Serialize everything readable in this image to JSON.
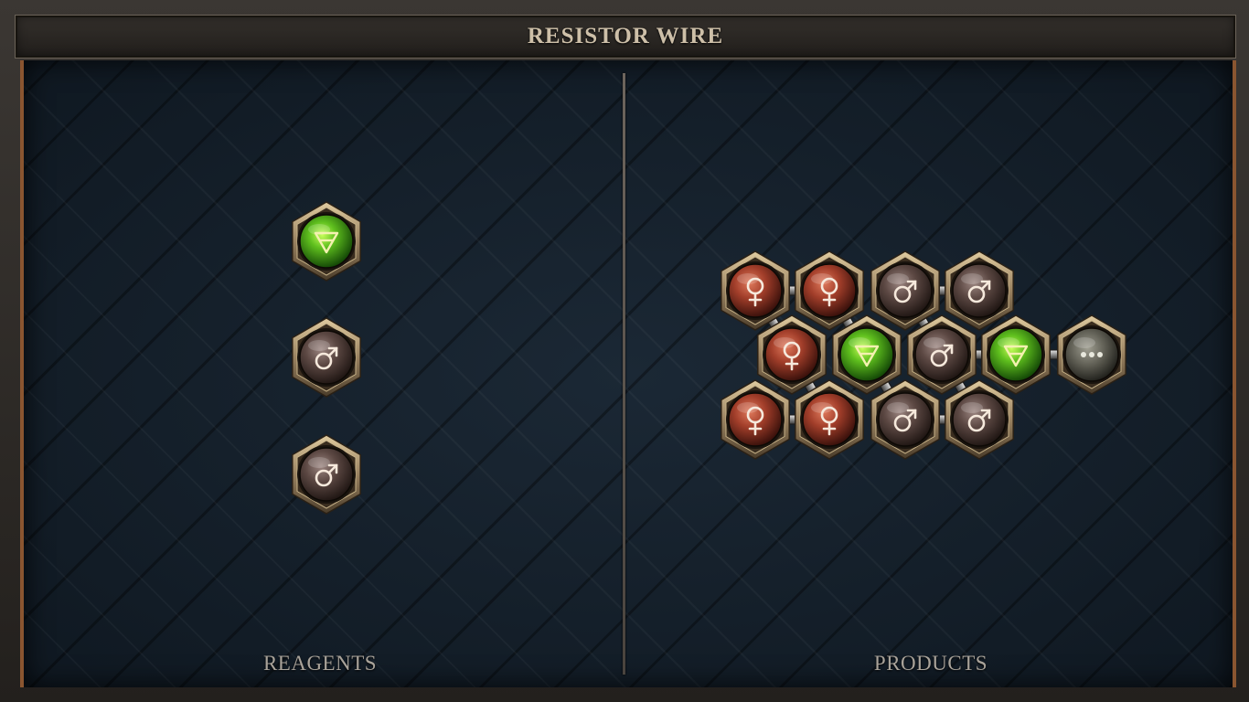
{
  "title": "RESISTOR WIRE",
  "panels": {
    "reagents_label": "REAGENTS",
    "products_label": "PRODUCTS"
  },
  "colors": {
    "copper": "#8a3524",
    "iron": "#5a4642",
    "earth": "#3e9a1c",
    "quicksilver": "#5a5a52",
    "bezel": "#b9a078"
  },
  "reagents": [
    {
      "element": "earth",
      "icon": "earth-triangle-icon"
    },
    {
      "element": "iron",
      "icon": "mars-icon"
    },
    {
      "element": "iron",
      "icon": "mars-icon"
    }
  ],
  "product": {
    "atoms": [
      {
        "element": "copper",
        "icon": "venus-icon"
      },
      {
        "element": "copper",
        "icon": "venus-icon"
      },
      {
        "element": "iron",
        "icon": "mars-icon"
      },
      {
        "element": "iron",
        "icon": "mars-icon"
      },
      {
        "element": "copper",
        "icon": "venus-icon"
      },
      {
        "element": "earth",
        "icon": "earth-triangle-icon"
      },
      {
        "element": "iron",
        "icon": "mars-icon"
      },
      {
        "element": "earth",
        "icon": "earth-triangle-icon"
      },
      {
        "element": "repeat",
        "icon": "ellipsis-icon"
      },
      {
        "element": "copper",
        "icon": "venus-icon"
      },
      {
        "element": "copper",
        "icon": "venus-icon"
      },
      {
        "element": "iron",
        "icon": "mars-icon"
      },
      {
        "element": "iron",
        "icon": "mars-icon"
      }
    ],
    "bond_count": 14
  }
}
